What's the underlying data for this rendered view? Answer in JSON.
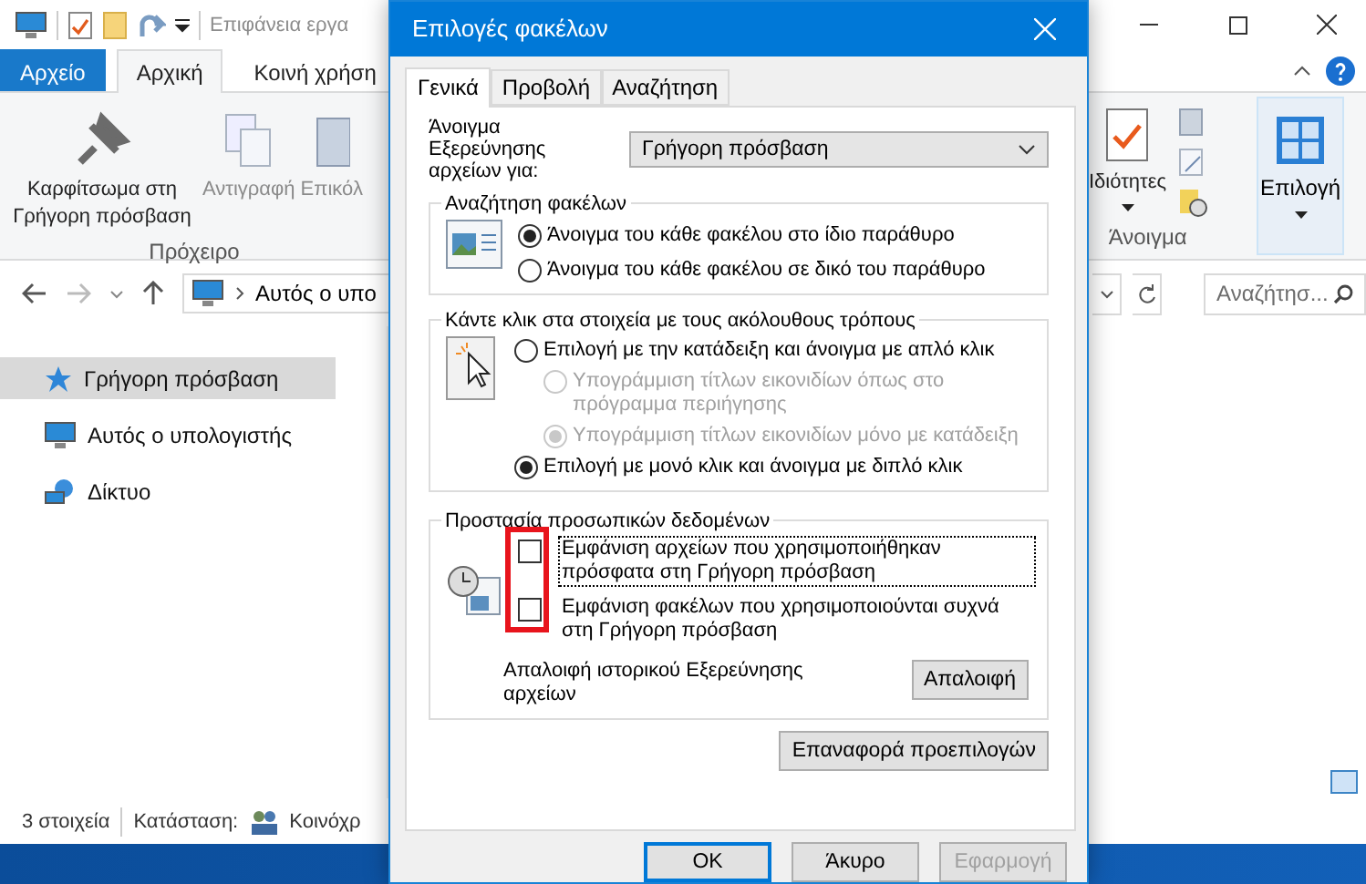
{
  "explorer": {
    "quick_access_title": "Επιφάνεια εργα",
    "ribbon_tabs": [
      {
        "label": "Αρχείο",
        "kind": "file",
        "selected": false
      },
      {
        "label": "Αρχική",
        "kind": "tab",
        "selected": true
      },
      {
        "label": "Κοινή χρήση",
        "kind": "tab",
        "selected": false
      }
    ],
    "clipboard_commands": [
      {
        "label": "Καρφίτσωμα στη Γρήγορη πρόσβαση",
        "kind": "pin",
        "disabled": false
      },
      {
        "label": "Αντιγραφή",
        "kind": "copy",
        "disabled": true
      },
      {
        "label": "Επικόλ",
        "kind": "paste",
        "disabled": true
      }
    ],
    "clipboard_group": "Πρόχειρο",
    "properties_command": "Ιδιότητες",
    "select_command": "Επιλογή",
    "open_group": "Άνοιγμα",
    "address": "Αυτός ο υπο",
    "search_placeholder": "Αναζήτησ...",
    "nav_items": [
      {
        "label": "Γρήγορη πρόσβαση",
        "kind": "quick",
        "selected": true
      },
      {
        "label": "Αυτός ο υπολογιστής",
        "kind": "pc",
        "selected": false
      },
      {
        "label": "Δίκτυο",
        "kind": "network",
        "selected": false
      }
    ],
    "status": {
      "items": "3 στοιχεία",
      "state_label": "Κατάσταση:",
      "state_value": "Κοινόχρ"
    }
  },
  "dialog": {
    "title": "Επιλογές φακέλων",
    "tabs": [
      {
        "label": "Γενικά",
        "selected": true
      },
      {
        "label": "Προβολή",
        "selected": false
      },
      {
        "label": "Αναζήτηση",
        "selected": false
      }
    ],
    "open_for": {
      "label": "Άνοιγμα Εξερεύνησης αρχείων για:",
      "value": "Γρήγορη πρόσβαση"
    },
    "browse_folders": {
      "title": "Αναζήτηση φακέλων",
      "options": [
        {
          "label": "Άνοιγμα του κάθε φακέλου στο ίδιο παράθυρο",
          "selected": true,
          "disabled": false
        },
        {
          "label": "Άνοιγμα του κάθε φακέλου σε δικό του παράθυρο",
          "selected": false,
          "disabled": false
        }
      ]
    },
    "click_items": {
      "title": "Κάντε κλικ στα στοιχεία με τους ακόλουθους τρόπους",
      "options": [
        {
          "label": "Επιλογή με την κατάδειξη και άνοιγμα με απλό κλικ",
          "selected": false,
          "disabled": false,
          "children": [
            {
              "label": "Υπογράμμιση τίτλων εικονιδίων όπως στο πρόγραμμα περιήγησης",
              "selected": false,
              "disabled": true
            },
            {
              "label": "Υπογράμμιση τίτλων εικονιδίων μόνο με κατάδειξη",
              "selected": true,
              "disabled": true
            }
          ]
        },
        {
          "label": "Επιλογή με μονό κλικ και άνοιγμα με διπλό κλικ",
          "selected": true,
          "disabled": false
        }
      ]
    },
    "privacy": {
      "title": "Προστασία προσωπικών δεδομένων",
      "highlighted": true,
      "options": [
        {
          "label": "Εμφάνιση αρχείων που χρησιμοποιήθηκαν πρόσφατα στη Γρήγορη πρόσβαση",
          "checked": false,
          "focused": true
        },
        {
          "label": "Εμφάνιση φακέλων που χρησιμοποιούνται συχνά στη Γρήγορη πρόσβαση",
          "checked": false,
          "focused": false
        }
      ],
      "clear_label": "Απαλοιφή ιστορικού Εξερεύνησης αρχείων",
      "clear_button": "Απαλοιφή"
    },
    "reset_button": "Επαναφορά προεπιλογών",
    "buttons": [
      {
        "label": "OK",
        "default": true,
        "disabled": false
      },
      {
        "label": "Άκυρο",
        "default": false,
        "disabled": false
      },
      {
        "label": "Εφαρμογή",
        "default": false,
        "disabled": true
      }
    ]
  }
}
